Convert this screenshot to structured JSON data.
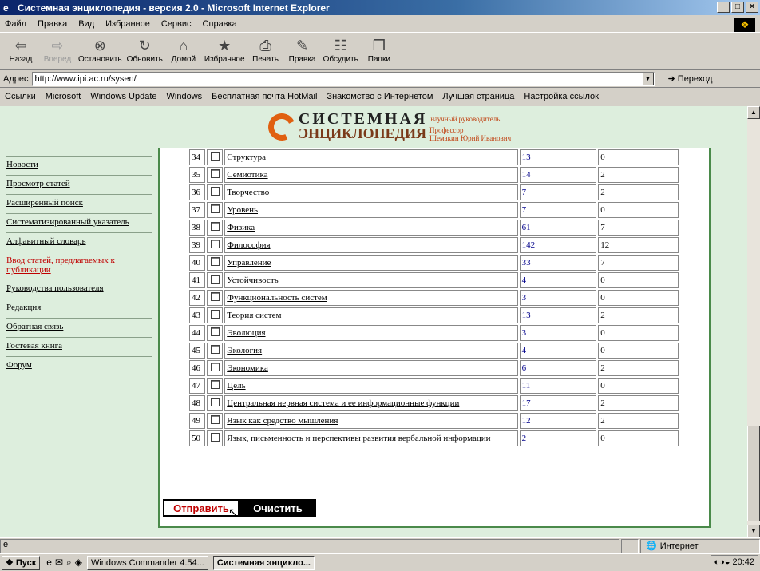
{
  "window": {
    "title": "Системная энциклопедия - версия 2.0 - Microsoft Internet Explorer",
    "buttons": [
      "_",
      "□",
      "×"
    ]
  },
  "menu": [
    "Файл",
    "Правка",
    "Вид",
    "Избранное",
    "Сервис",
    "Справка"
  ],
  "toolbar": [
    {
      "label": "Назад",
      "icon": "⇦"
    },
    {
      "label": "Вперед",
      "icon": "⇨"
    },
    {
      "label": "Остановить",
      "icon": "⊗"
    },
    {
      "label": "Обновить",
      "icon": "↻"
    },
    {
      "label": "Домой",
      "icon": "⌂"
    },
    {
      "label": "Избранное",
      "icon": "★"
    },
    {
      "label": "Печать",
      "icon": "⎙"
    },
    {
      "label": "Правка",
      "icon": "✎"
    },
    {
      "label": "Обсудить",
      "icon": "☷"
    },
    {
      "label": "Папки",
      "icon": "❐"
    }
  ],
  "address": {
    "label": "Адрес",
    "url": "http://www.ipi.ac.ru/sysen/",
    "go": "Переход"
  },
  "links": {
    "label": "Ссылки",
    "items": [
      "Microsoft",
      "Windows Update",
      "Windows",
      "Бесплатная почта HotMail",
      "Знакомство с Интернетом",
      "Лучшая страница",
      "Настройка ссылок"
    ]
  },
  "logo": {
    "line1": "СИСТЕМНАЯ",
    "line2": "ЭНЦИКЛОПЕДИЯ",
    "sub1": "научный руководитель",
    "sub2": "Профессор",
    "sub3": "Шемакин Юрий Иванович"
  },
  "sidebar": [
    "Новости",
    "Просмотр статей",
    "Расширенный поиск",
    "Систематизированный указатель",
    "Алфавитный словарь",
    "Ввод статей, предлагаемых к публикации",
    "Руководства пользователя",
    "Редакция",
    "Обратная связь",
    "Гостевая книга",
    "Форум"
  ],
  "rows": [
    [
      "34",
      "Структура",
      "13",
      "0"
    ],
    [
      "35",
      "Семиотика",
      "14",
      "2"
    ],
    [
      "36",
      "Творчество",
      "7",
      "2"
    ],
    [
      "37",
      "Уровень",
      "7",
      "0"
    ],
    [
      "38",
      "Физика",
      "61",
      "7"
    ],
    [
      "39",
      "Философия",
      "142",
      "12"
    ],
    [
      "40",
      "Управление",
      "33",
      "7"
    ],
    [
      "41",
      "Устойчивость",
      "4",
      "0"
    ],
    [
      "42",
      "Функциональность систем",
      "3",
      "0"
    ],
    [
      "43",
      "Теория систем",
      "13",
      "2"
    ],
    [
      "44",
      "Эволюция",
      "3",
      "0"
    ],
    [
      "45",
      "Экология",
      "4",
      "0"
    ],
    [
      "46",
      "Экономика",
      "6",
      "2"
    ],
    [
      "47",
      "Цель",
      "11",
      "0"
    ],
    [
      "48",
      "Центральная нервная система и ее информационные функции",
      "17",
      "2"
    ],
    [
      "49",
      "Язык как средство мышления",
      "12",
      "2"
    ],
    [
      "50",
      "Язык, письменность и перспективы развития вербальной информации",
      "2",
      "0"
    ]
  ],
  "form": {
    "send": "Отправить",
    "clear": "Очистить"
  },
  "status": {
    "zone": "Интернет"
  },
  "taskbar": {
    "start": "Пуск",
    "tasks": [
      "Windows Commander 4.54...",
      "Системная энцикло..."
    ],
    "time": "20:42"
  }
}
